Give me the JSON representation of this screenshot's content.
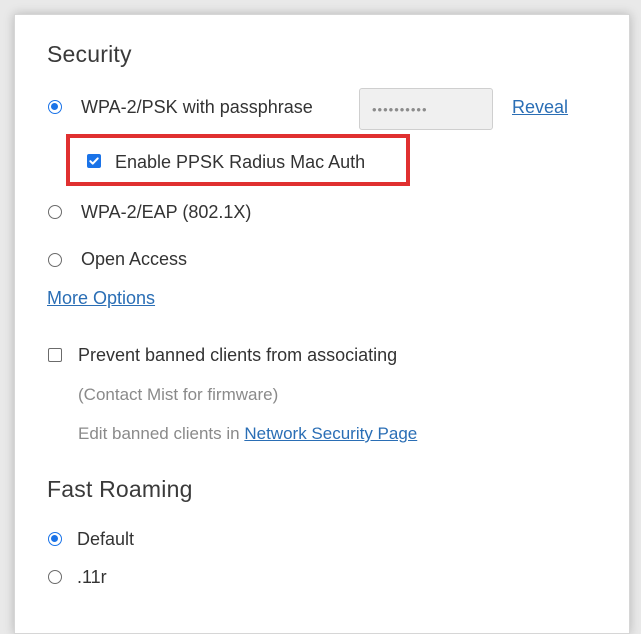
{
  "security": {
    "title": "Security",
    "options": [
      {
        "label": "WPA-2/PSK with passphrase",
        "checked": true
      },
      {
        "label": "WPA-2/EAP (802.1X)",
        "checked": false
      },
      {
        "label": "Open Access",
        "checked": false
      }
    ],
    "passphrase_value": "••••••••••",
    "reveal_label": "Reveal",
    "ppsk_radius_label": "Enable PPSK Radius Mac Auth",
    "ppsk_radius_checked": true,
    "more_options_label": "More Options",
    "prevent_banned_label": "Prevent banned clients from associating",
    "prevent_banned_checked": false,
    "firmware_note": "(Contact Mist for firmware)",
    "edit_banned_prefix": "Edit banned clients in",
    "network_security_link": "Network Security Page"
  },
  "fast_roaming": {
    "title": "Fast Roaming",
    "options": [
      {
        "label": "Default",
        "checked": true
      },
      {
        "label": ".11r",
        "checked": false
      }
    ]
  },
  "colors": {
    "accent": "#1a73e8",
    "link": "#2a6eb5",
    "highlight": "#e03030"
  }
}
